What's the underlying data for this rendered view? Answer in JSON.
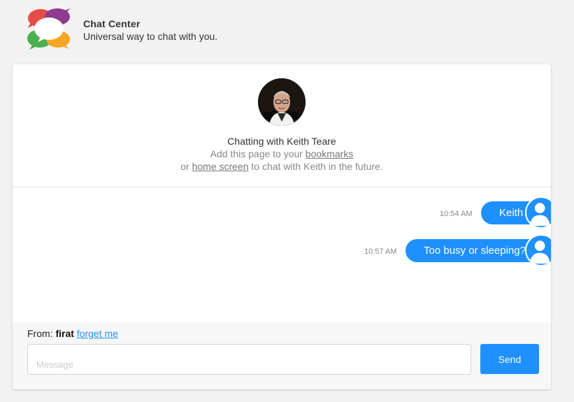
{
  "header": {
    "title": "Chat Center",
    "subtitle": "Universal way to chat with you."
  },
  "intro": {
    "title": "Chatting with Keith Teare",
    "line1_prefix": "Add this page to your ",
    "bookmarks_link": "bookmarks",
    "line2_prefix": "or ",
    "home_screen_link": "home screen",
    "line2_suffix": " to chat with Keith in the future."
  },
  "messages": [
    {
      "time": "10:54 AM",
      "text": "Keith"
    },
    {
      "time": "10:57 AM",
      "text": "Too busy or sleeping?"
    }
  ],
  "compose": {
    "from_label": "From:",
    "from_name": "firat",
    "forget_link": "forget me",
    "placeholder": "Message",
    "send_label": "Send"
  },
  "colors": {
    "accent": "#1e90ff",
    "background": "#f2f2f2",
    "logo_purple": "#8e3a8f",
    "logo_red": "#e74c4c",
    "logo_green": "#4caf50",
    "logo_orange": "#f5a623"
  }
}
